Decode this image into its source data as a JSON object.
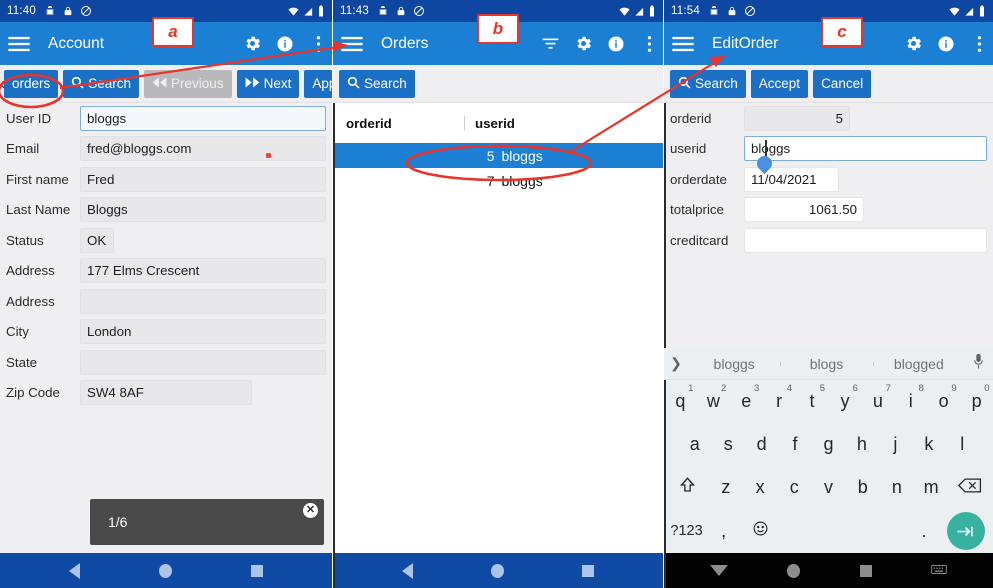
{
  "panels": [
    {
      "id": "a",
      "annotation": "a",
      "statusbar": {
        "clock": "11:40",
        "icons_left": [
          "bug-icon",
          "lock-icon",
          "no-silence-icon"
        ],
        "icons_right": [
          "wifi-icon",
          "signal-icon",
          "battery-icon"
        ]
      },
      "appbar": {
        "title": "Account",
        "menu_icon": "hamburger-icon",
        "actions": [
          "gear-icon",
          "info-icon",
          "overflow-icon"
        ]
      },
      "toolbar": [
        {
          "label": "orders",
          "icon": "",
          "state": "enabled"
        },
        {
          "label": "Search",
          "icon": "search-icon",
          "state": "enabled"
        },
        {
          "label": "Previous",
          "icon": "rewind-icon",
          "state": "disabled"
        },
        {
          "label": "Next",
          "icon": "forward-icon",
          "state": "enabled"
        },
        {
          "label": "Append",
          "icon": "",
          "state": "enabled"
        }
      ],
      "fields": [
        {
          "label": "User ID",
          "value": "bloggs",
          "focused": true,
          "width": "full"
        },
        {
          "label": "Email",
          "value": "fred@bloggs.com",
          "focused": false,
          "width": "full"
        },
        {
          "label": "First name",
          "value": "Fred",
          "focused": false,
          "width": "full"
        },
        {
          "label": "Last Name",
          "value": "Bloggs",
          "focused": false,
          "width": "full"
        },
        {
          "label": "Status",
          "value": "OK",
          "focused": false,
          "width": "narrow"
        },
        {
          "label": "Address",
          "value": "177 Elms Crescent",
          "focused": false,
          "width": "full"
        },
        {
          "label": "Address",
          "value": "",
          "focused": false,
          "width": "full"
        },
        {
          "label": "City",
          "value": "London",
          "focused": false,
          "width": "full"
        },
        {
          "label": "State",
          "value": "",
          "focused": false,
          "width": "full"
        },
        {
          "label": "Zip Code",
          "value": "SW4 8AF",
          "focused": false,
          "width": "zip"
        }
      ],
      "toast": {
        "text": "1/6",
        "close_icon": "close-icon"
      },
      "navbar": {
        "icons": [
          "back-icon",
          "home-icon",
          "recents-icon"
        ]
      }
    },
    {
      "id": "b",
      "annotation": "b",
      "statusbar": {
        "clock": "11:43",
        "icons_left": [
          "bug-icon",
          "lock-icon",
          "no-silence-icon"
        ],
        "icons_right": [
          "wifi-icon",
          "signal-icon",
          "battery-icon"
        ]
      },
      "appbar": {
        "title": "Orders",
        "menu_icon": "hamburger-icon",
        "actions": [
          "filter-icon",
          "gear-icon",
          "info-icon",
          "overflow-icon"
        ]
      },
      "toolbar": [
        {
          "label": "Search",
          "icon": "search-icon",
          "state": "enabled"
        }
      ],
      "table": {
        "columns": [
          "orderid",
          "userid"
        ],
        "rows": [
          {
            "orderid": "5",
            "userid": "bloggs",
            "selected": true
          },
          {
            "orderid": "7",
            "userid": "bloggs",
            "selected": false
          }
        ]
      },
      "navbar": {
        "icons": [
          "back-icon",
          "home-icon",
          "recents-icon"
        ]
      }
    },
    {
      "id": "c",
      "annotation": "c",
      "statusbar": {
        "clock": "11:54",
        "icons_left": [
          "bug-icon",
          "lock-icon",
          "no-silence-icon"
        ],
        "icons_right": [
          "wifi-icon",
          "signal-icon",
          "battery-icon"
        ]
      },
      "appbar": {
        "title": "EditOrder",
        "menu_icon": "hamburger-icon",
        "actions": [
          "gear-icon",
          "info-icon",
          "overflow-icon"
        ]
      },
      "toolbar": [
        {
          "label": "Search",
          "icon": "search-icon",
          "state": "enabled"
        },
        {
          "label": "Accept",
          "icon": "",
          "state": "enabled"
        },
        {
          "label": "Cancel",
          "icon": "",
          "state": "enabled"
        }
      ],
      "fields": [
        {
          "label": "orderid",
          "value": "5",
          "focused": false,
          "width": "short",
          "align": "right"
        },
        {
          "label": "userid",
          "value": "bloggs",
          "focused": true,
          "width": "full",
          "align": "left"
        },
        {
          "label": "orderdate",
          "value": "11/04/2021",
          "focused": false,
          "width": "date",
          "align": "left"
        },
        {
          "label": "totalprice",
          "value": "1061.50",
          "focused": false,
          "width": "price",
          "align": "right"
        },
        {
          "label": "creditcard",
          "value": "",
          "focused": false,
          "width": "full",
          "align": "left"
        }
      ],
      "keyboard": {
        "suggestions": [
          "bloggs",
          "blogs",
          "blogged"
        ],
        "expand_icon": "chevron-right-icon",
        "mic_icon": "microphone-icon",
        "row1": [
          {
            "k": "q",
            "n": "1"
          },
          {
            "k": "w",
            "n": "2"
          },
          {
            "k": "e",
            "n": "3"
          },
          {
            "k": "r",
            "n": "4"
          },
          {
            "k": "t",
            "n": "5"
          },
          {
            "k": "y",
            "n": "6"
          },
          {
            "k": "u",
            "n": "7"
          },
          {
            "k": "i",
            "n": "8"
          },
          {
            "k": "o",
            "n": "9"
          },
          {
            "k": "p",
            "n": "0"
          }
        ],
        "row2": [
          "a",
          "s",
          "d",
          "f",
          "g",
          "h",
          "j",
          "k",
          "l"
        ],
        "row3": [
          "z",
          "x",
          "c",
          "v",
          "b",
          "n",
          "m"
        ],
        "shift_icon": "shift-icon",
        "backspace_icon": "backspace-icon",
        "symbols_key": "?123",
        "comma_key": ",",
        "emoji_icon": "emoji-icon",
        "period_key": ".",
        "enter_icon": "enter-icon"
      },
      "navbar": {
        "icons": [
          "down-arrow-icon",
          "home-icon",
          "recents-icon",
          "keyboard-icon"
        ]
      }
    }
  ],
  "colors": {
    "statusbar_blue": "#0d47a1",
    "appbar_blue": "#1b7fd4",
    "button_blue": "#1b6fc4",
    "annotation_red": "#e8342a",
    "navbar_blue": "#0f4ba4",
    "keyboard_bg": "#eceff1",
    "enter_teal": "#38b2a0"
  }
}
